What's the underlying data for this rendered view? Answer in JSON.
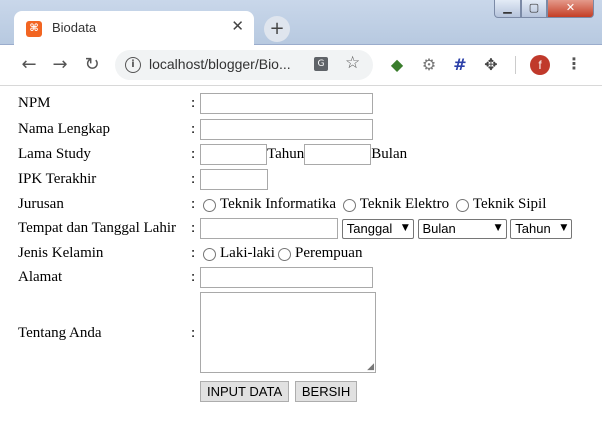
{
  "browser": {
    "tab_title": "Biodata",
    "tab_close": "✕",
    "new_tab": "+",
    "url": "localhost/blogger/Bio...",
    "profile_initial": "f",
    "window_min": "▁",
    "window_max": "▢",
    "window_close": "✕"
  },
  "form": {
    "colon": ":",
    "npm": {
      "label": "NPM",
      "value": ""
    },
    "nama": {
      "label": "Nama Lengkap",
      "value": ""
    },
    "lama_study": {
      "label": "Lama Study",
      "tahun_label": "Tahun",
      "bulan_label": "Bulan",
      "tahun_value": "",
      "bulan_value": ""
    },
    "ipk": {
      "label": "IPK Terakhir",
      "value": ""
    },
    "jurusan": {
      "label": "Jurusan",
      "options": [
        "Teknik Informatika",
        "Teknik Elektro",
        "Teknik Sipil"
      ]
    },
    "ttl": {
      "label": "Tempat dan Tanggal Lahir",
      "value": "",
      "tanggal": "Tanggal",
      "bulan": "Bulan",
      "tahun": "Tahun"
    },
    "jenis_kelamin": {
      "label": "Jenis Kelamin",
      "options": [
        "Laki-laki",
        "Perempuan"
      ]
    },
    "alamat": {
      "label": "Alamat",
      "value": ""
    },
    "tentang": {
      "label": "Tentang Anda",
      "value": ""
    },
    "buttons": {
      "submit": "INPUT DATA",
      "reset": "BERSIH"
    }
  },
  "colors": {
    "titlebar": "#c9d7ea",
    "close_button": "#c43e25",
    "avatar": "#c0392b",
    "favicon": "#f26522"
  }
}
